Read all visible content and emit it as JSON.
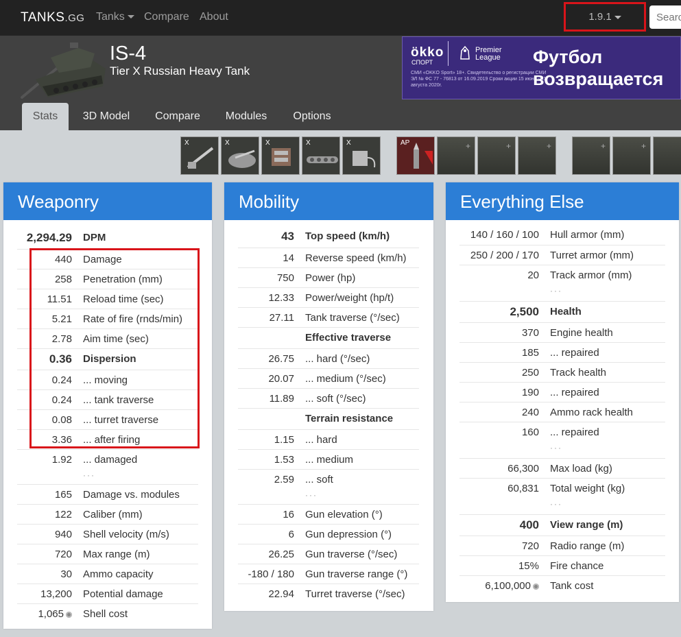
{
  "nav": {
    "brand_main": "TANKS",
    "brand_suffix": ".GG",
    "tanks": "Tanks",
    "compare": "Compare",
    "about": "About",
    "version": "1.9.1",
    "search_placeholder": "Search"
  },
  "tank": {
    "name": "IS-4",
    "subtitle": "Tier X Russian Heavy Tank"
  },
  "ad": {
    "brand": "ökko",
    "sport": "СПОРТ",
    "league_line1": "Premier",
    "league_line2": "League",
    "fine_print": "СМИ «OKKO Sport» 18+. Свидетельство о регистрации СМИ ЭЛ № ФС 77 - 76813 от 16.09.2019 Сроки акции 15 июня - 31 августа 2020г.",
    "headline1": "Футбол",
    "headline2": "возвращается"
  },
  "tabs": [
    "Stats",
    "3D Model",
    "Compare",
    "Modules",
    "Options"
  ],
  "modules": {
    "labels": [
      "X",
      "X",
      "X",
      "X",
      "X"
    ],
    "icons": [
      "gun-module-icon",
      "turret-module-icon",
      "engine-module-icon",
      "suspension-module-icon",
      "radio-module-icon"
    ],
    "ammo_label": "AP"
  },
  "weaponry": {
    "title": "Weaponry",
    "rows": [
      {
        "v": "2,294.29",
        "l": "DPM",
        "bold": true
      },
      {
        "v": "440",
        "l": "Damage"
      },
      {
        "v": "258",
        "l": "Penetration (mm)"
      },
      {
        "v": "11.51",
        "l": "Reload time (sec)"
      },
      {
        "v": "5.21",
        "l": "Rate of fire (rnds/min)"
      },
      {
        "v": "2.78",
        "l": "Aim time (sec)"
      },
      {
        "v": "0.36",
        "l": "Dispersion",
        "bold": true
      },
      {
        "v": "0.24",
        "l": "... moving"
      },
      {
        "v": "0.24",
        "l": "... tank traverse"
      },
      {
        "v": "0.08",
        "l": "... turret traverse"
      },
      {
        "v": "3.36",
        "l": "... after firing"
      },
      {
        "v": "1.92",
        "l": "... damaged"
      },
      {
        "dots": true
      },
      {
        "v": "165",
        "l": "Damage vs. modules"
      },
      {
        "v": "122",
        "l": "Caliber (mm)"
      },
      {
        "v": "940",
        "l": "Shell velocity (m/s)"
      },
      {
        "v": "720",
        "l": "Max range (m)"
      },
      {
        "v": "30",
        "l": "Ammo capacity"
      },
      {
        "v": "13,200",
        "l": "Potential damage"
      },
      {
        "v": "1,065",
        "l": "Shell cost",
        "coin": true
      }
    ]
  },
  "mobility": {
    "title": "Mobility",
    "rows": [
      {
        "v": "43",
        "l": "Top speed (km/h)",
        "bold": true
      },
      {
        "v": "14",
        "l": "Reverse speed (km/h)"
      },
      {
        "v": "750",
        "l": "Power (hp)"
      },
      {
        "v": "12.33",
        "l": "Power/weight (hp/t)"
      },
      {
        "v": "27.11",
        "l": "Tank traverse (°/sec)"
      },
      {
        "v": "",
        "l": "Effective traverse",
        "bold": true
      },
      {
        "v": "26.75",
        "l": "... hard (°/sec)"
      },
      {
        "v": "20.07",
        "l": "... medium (°/sec)"
      },
      {
        "v": "11.89",
        "l": "... soft (°/sec)"
      },
      {
        "v": "",
        "l": "Terrain resistance",
        "bold": true
      },
      {
        "v": "1.15",
        "l": "... hard"
      },
      {
        "v": "1.53",
        "l": "... medium"
      },
      {
        "v": "2.59",
        "l": "... soft"
      },
      {
        "dots": true
      },
      {
        "v": "16",
        "l": "Gun elevation (°)"
      },
      {
        "v": "6",
        "l": "Gun depression (°)"
      },
      {
        "v": "26.25",
        "l": "Gun traverse (°/sec)"
      },
      {
        "v": "-180 / 180",
        "l": "Gun traverse range (°)"
      },
      {
        "v": "22.94",
        "l": "Turret traverse (°/sec)"
      }
    ]
  },
  "else": {
    "title": "Everything Else",
    "rows": [
      {
        "v": "140 / 160 / 100",
        "l": "Hull armor (mm)"
      },
      {
        "v": "250 / 200 / 170",
        "l": "Turret armor (mm)"
      },
      {
        "v": "20",
        "l": "Track armor (mm)"
      },
      {
        "dots": true
      },
      {
        "v": "2,500",
        "l": "Health",
        "bold": true
      },
      {
        "v": "370",
        "l": "Engine health"
      },
      {
        "v": "185",
        "l": "... repaired"
      },
      {
        "v": "250",
        "l": "Track health"
      },
      {
        "v": "190",
        "l": "... repaired"
      },
      {
        "v": "240",
        "l": "Ammo rack health"
      },
      {
        "v": "160",
        "l": "... repaired"
      },
      {
        "dots": true
      },
      {
        "v": "66,300",
        "l": "Max load (kg)"
      },
      {
        "v": "60,831",
        "l": "Total weight (kg)"
      },
      {
        "dots": true
      },
      {
        "v": "400",
        "l": "View range (m)",
        "bold": true
      },
      {
        "v": "720",
        "l": "Radio range (m)"
      },
      {
        "v": "15%",
        "l": "Fire chance"
      },
      {
        "v": "6,100,000",
        "l": "Tank cost",
        "coin": true
      }
    ]
  },
  "colors": {
    "panel_header": "#2c7ed6",
    "highlight": "#d9141a",
    "navbar": "#222222",
    "header_band": "#414141"
  }
}
